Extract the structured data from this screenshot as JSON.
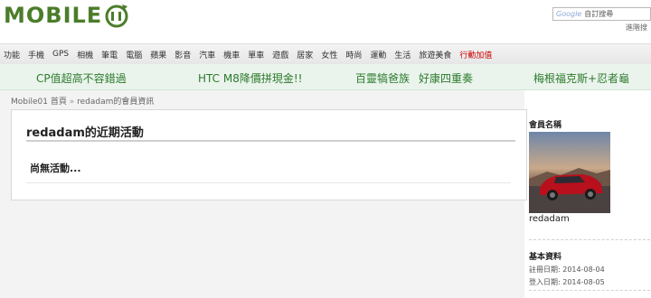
{
  "header": {
    "logo_text": "MOBILE",
    "search_brand": "Google",
    "search_placeholder": "自訂搜尋",
    "advanced_link": "進階搜"
  },
  "nav": [
    {
      "label": "功能"
    },
    {
      "label": "手機"
    },
    {
      "label": "GPS"
    },
    {
      "label": "相機"
    },
    {
      "label": "筆電"
    },
    {
      "label": "電腦"
    },
    {
      "label": "蘋果"
    },
    {
      "label": "影音"
    },
    {
      "label": "汽車"
    },
    {
      "label": "機車"
    },
    {
      "label": "單車"
    },
    {
      "label": "遊戲"
    },
    {
      "label": "居家"
    },
    {
      "label": "女性"
    },
    {
      "label": "時尚"
    },
    {
      "label": "運動"
    },
    {
      "label": "生活"
    },
    {
      "label": "旅遊美食"
    },
    {
      "label": "行動加值",
      "highlight": true
    }
  ],
  "promo": [
    "CP值超高不容錯過",
    "HTC M8降價拼現金!!",
    "百靈犒爸族",
    "好康四重奏",
    "梅根福克斯+忍者龜"
  ],
  "breadcrumb": {
    "home": "Mobile01 首頁",
    "separator": "»",
    "current": "redadam的會員資訊"
  },
  "activity": {
    "title": "redadam的近期活動",
    "empty_text": "尚無活動..."
  },
  "sidebar": {
    "member_heading": "會員名稱",
    "username": "redadam",
    "info_heading": "基本資料",
    "registered": "註冊日期: 2014-08-04",
    "last_login": "登入日期: 2014-08-05"
  },
  "colors": {
    "brand_green": "#4b7d2a",
    "promo_green": "#2d7a2d",
    "highlight_red": "#cc0000"
  }
}
